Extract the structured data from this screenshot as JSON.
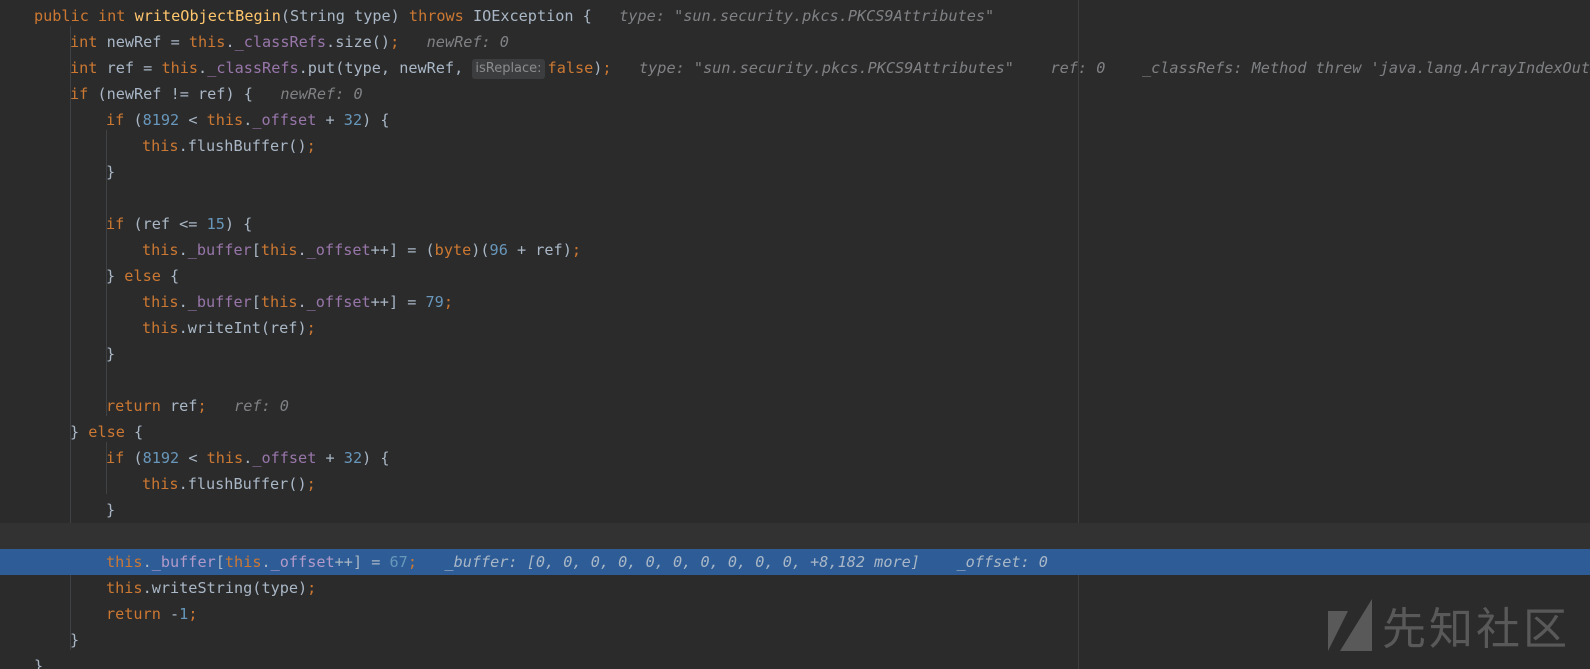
{
  "editor": {
    "lines": [
      {
        "text": "public int writeObjectBegin(String type) throws IOException {"
      },
      {
        "text": "int newRef = this._classRefs.size();"
      },
      {
        "text": "int ref = this._classRefs.put(type, newRef, false);"
      },
      {
        "text": "if (newRef != ref) {"
      },
      {
        "text": "if (8192 < this._offset + 32) {"
      },
      {
        "text": "this.flushBuffer();"
      },
      {
        "text": "}"
      },
      {
        "text": ""
      },
      {
        "text": "if (ref <= 15) {"
      },
      {
        "text": "this._buffer[this._offset++] = (byte)(96 + ref);"
      },
      {
        "text": "} else {"
      },
      {
        "text": "this._buffer[this._offset++] = 79;"
      },
      {
        "text": "this.writeInt(ref);"
      },
      {
        "text": "}"
      },
      {
        "text": ""
      },
      {
        "text": "return ref;"
      },
      {
        "text": "} else {"
      },
      {
        "text": "if (8192 < this._offset + 32) {"
      },
      {
        "text": "this.flushBuffer();"
      },
      {
        "text": "}"
      },
      {
        "text": ""
      },
      {
        "text": "this._buffer[this._offset++] = 67;"
      },
      {
        "text": "this.writeString(type);"
      },
      {
        "text": "return -1;"
      },
      {
        "text": "}"
      },
      {
        "text": "}"
      }
    ],
    "parameter_hints": {
      "line3_param": "isReplace:"
    },
    "inline_values": {
      "line1": "type: \"sun.security.pkcs.PKCS9Attributes\"",
      "line2": "newRef: 0",
      "line3_type": "type: \"sun.security.pkcs.PKCS9Attributes\"",
      "line3_ref": "ref: 0",
      "line3_classRefs": "_classRefs: Method threw 'java.lang.ArrayIndexOutOfBoundsException' exception.",
      "line4": "newRef: 0",
      "line16": "ref: 0",
      "line22_buffer": "_buffer: [0, 0, 0, 0, 0, 0, 0, 0, 0, 0, +8,182 more]",
      "line22_offset": "_offset: 0"
    },
    "execution_line": 22,
    "colors": {
      "background": "#2b2b2b",
      "execution_highlight": "#2d5c97",
      "keyword": "#cc7832",
      "method_declaration": "#ffc66d",
      "field": "#9876aa",
      "number": "#6897bb",
      "inline_hint": "#7f8184"
    }
  },
  "watermark": {
    "text": "先知社区",
    "icon": "xianzhi-logo-icon"
  }
}
